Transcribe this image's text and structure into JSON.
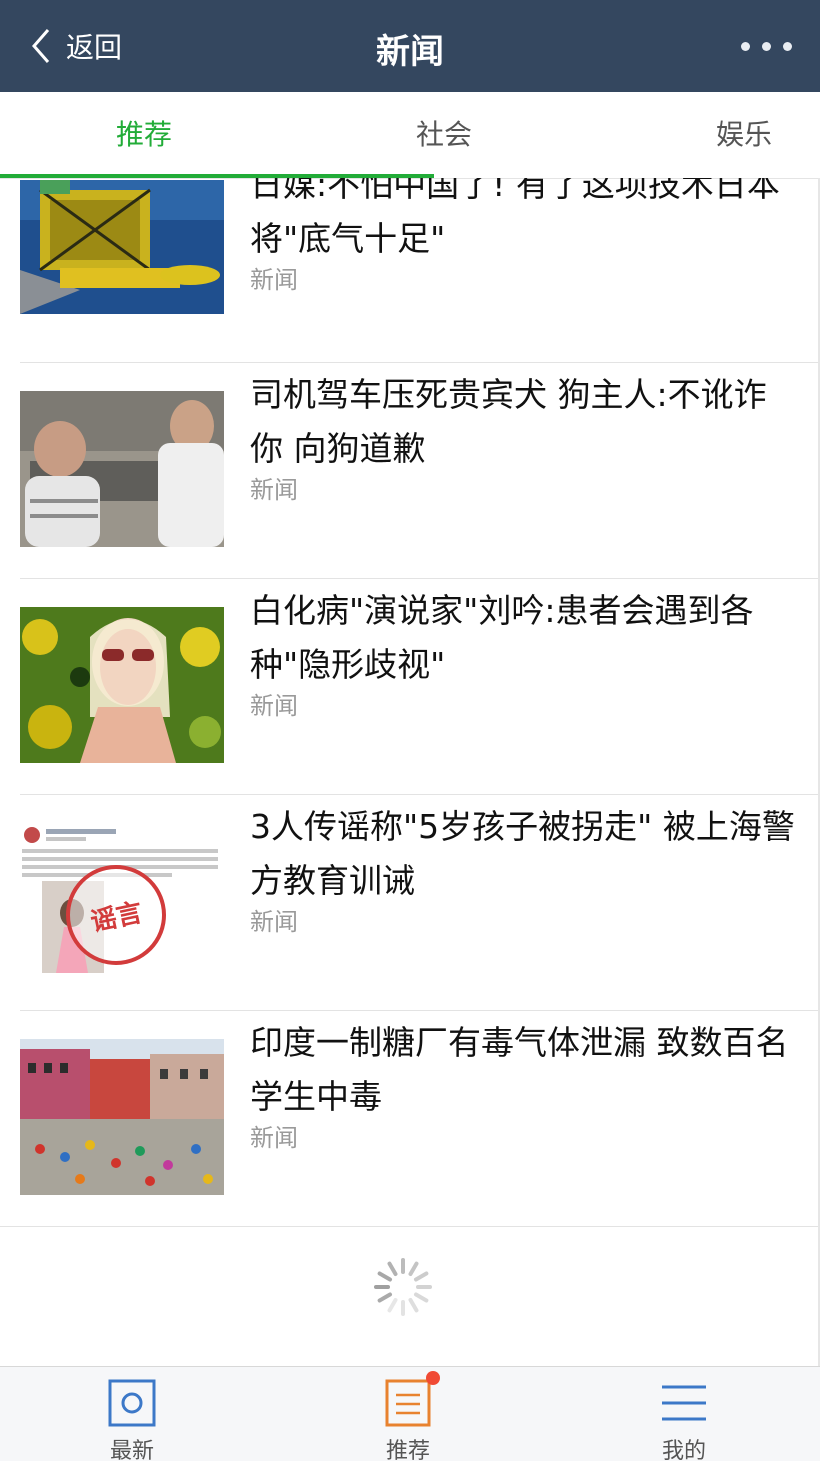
{
  "header": {
    "back_label": "返回",
    "title": "新闻",
    "more_icon": "more-dots-icon"
  },
  "tabs": [
    {
      "label": "推荐",
      "active": true
    },
    {
      "label": "社会",
      "active": false
    },
    {
      "label": "娱乐",
      "active": false
    }
  ],
  "news": [
    {
      "headline": "日媒:不怕中国了! 有了这项技术日本将\"底气十足\"",
      "source": "新闻",
      "thumb": "deep-sea-vehicle-photo"
    },
    {
      "headline": "司机驾车压死贵宾犬 狗主人:不讹诈你 向狗道歉",
      "source": "新闻",
      "thumb": "two-people-street-photo"
    },
    {
      "headline": "白化病\"演说家\"刘吟:患者会遇到各种\"隐形歧视\"",
      "source": "新闻",
      "thumb": "woman-speaker-photo"
    },
    {
      "headline": "3人传谣称\"5岁孩子被拐走\" 被上海警方教育训诫",
      "source": "新闻",
      "thumb": "rumor-screenshot-photo"
    },
    {
      "headline": "印度一制糖厂有毒气体泄漏 致数百名学生中毒",
      "source": "新闻",
      "thumb": "india-riverside-photo"
    }
  ],
  "rumor_stamp": "谣言",
  "bottom_nav": [
    {
      "label": "最新",
      "icon": "latest-icon"
    },
    {
      "label": "推荐",
      "icon": "recommend-icon",
      "badge": true
    },
    {
      "label": "我的",
      "icon": "menu-lines-icon"
    }
  ],
  "colors": {
    "header_bg": "#34475f",
    "accent_green": "#22ac38",
    "nav_blue": "#3c78c8",
    "nav_orange": "#e8822f",
    "badge_red": "#f04a34"
  }
}
